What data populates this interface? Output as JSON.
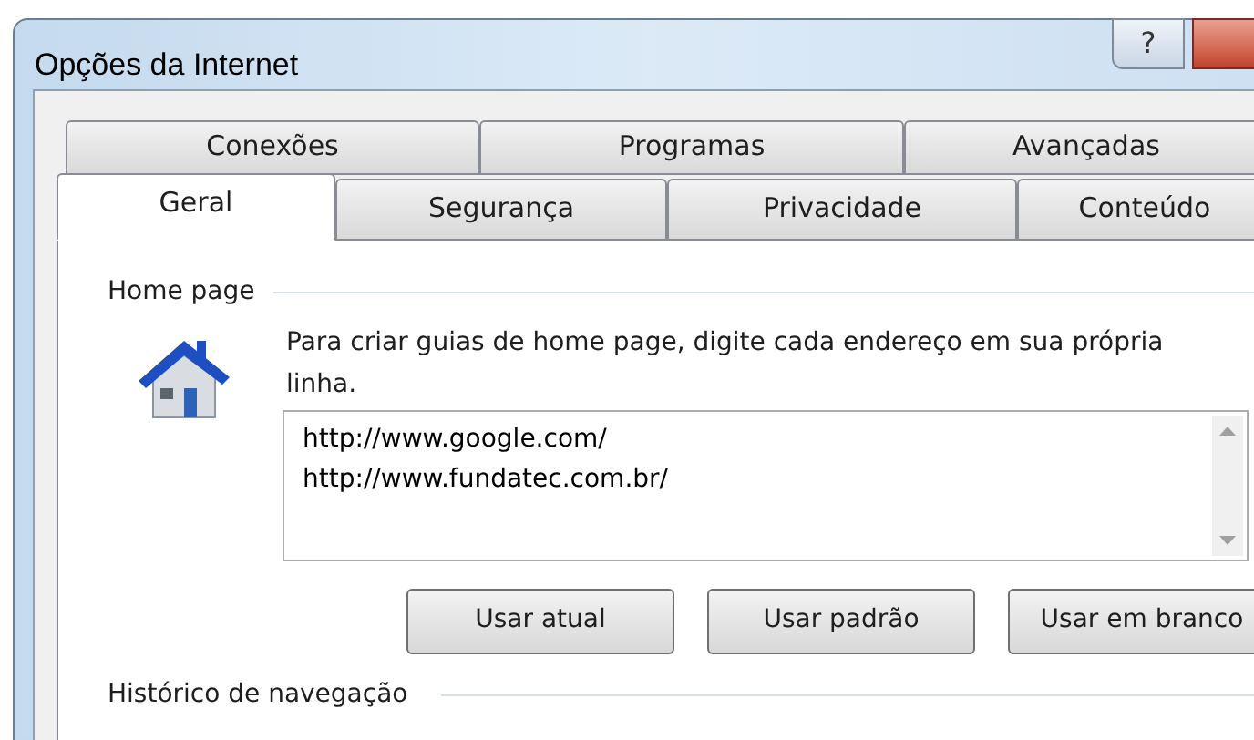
{
  "window": {
    "title": "Opções da Internet",
    "help_button": "?"
  },
  "tab_rows": [
    [
      {
        "label": "Conexões",
        "selected": false
      },
      {
        "label": "Programas",
        "selected": false
      },
      {
        "label": "Avançadas",
        "selected": false
      }
    ],
    [
      {
        "label": "Geral",
        "selected": true
      },
      {
        "label": "Segurança",
        "selected": false
      },
      {
        "label": "Privacidade",
        "selected": false
      },
      {
        "label": "Conteúdo",
        "selected": false
      }
    ]
  ],
  "home_page": {
    "heading": "Home page",
    "description": "Para criar guias de home page, digite cada endereço em sua própria linha.",
    "addresses": [
      "http://www.google.com/",
      "http://www.fundatec.com.br/"
    ],
    "buttons": [
      "Usar atual",
      "Usar padrão",
      "Usar em branco"
    ]
  },
  "history": {
    "heading": "Histórico de navegação"
  }
}
